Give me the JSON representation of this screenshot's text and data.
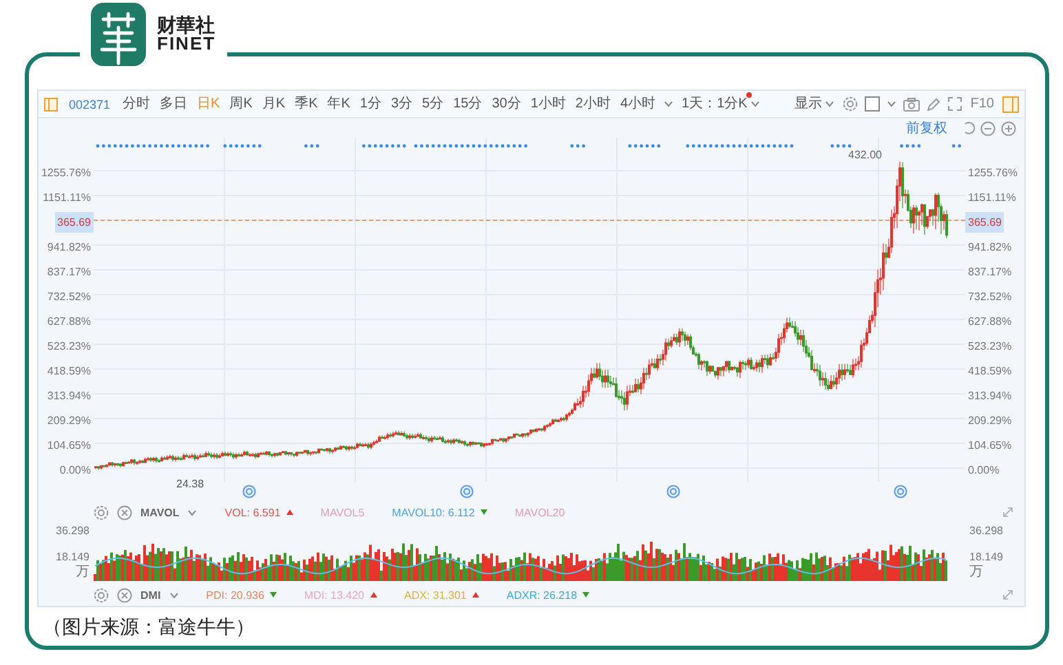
{
  "logo": {
    "name": "财華社",
    "latin": "FINET"
  },
  "toolbar": {
    "code": "002371",
    "periods": [
      {
        "label": "分时",
        "selected": false
      },
      {
        "label": "多日",
        "selected": false
      },
      {
        "label": "日K",
        "selected": true
      },
      {
        "label": "周K",
        "selected": false
      },
      {
        "label": "月K",
        "selected": false
      },
      {
        "label": "季K",
        "selected": false
      },
      {
        "label": "年K",
        "selected": false
      },
      {
        "label": "1分",
        "selected": false
      },
      {
        "label": "3分",
        "selected": false
      },
      {
        "label": "5分",
        "selected": false
      },
      {
        "label": "15分",
        "selected": false
      },
      {
        "label": "30分",
        "selected": false
      },
      {
        "label": "1小时",
        "selected": false
      },
      {
        "label": "2小时",
        "selected": false
      },
      {
        "label": "4小时",
        "selected": false
      }
    ],
    "interval": {
      "label": "1天：1分K",
      "alert": true
    },
    "display": "显示",
    "f10": "F10"
  },
  "chart": {
    "adjust": "前复权",
    "high_label": "432.00",
    "low_label": "24.38",
    "left_axis": [
      {
        "text": "1255.76%",
        "highlighted": false
      },
      {
        "text": "1151.11%",
        "highlighted": false
      },
      {
        "text": "365.69",
        "highlighted": true
      },
      {
        "text": "941.82%",
        "highlighted": false
      },
      {
        "text": "837.17%",
        "highlighted": false
      },
      {
        "text": "732.52%",
        "highlighted": false
      },
      {
        "text": "627.88%",
        "highlighted": false
      },
      {
        "text": "523.23%",
        "highlighted": false
      },
      {
        "text": "418.59%",
        "highlighted": false
      },
      {
        "text": "313.94%",
        "highlighted": false
      },
      {
        "text": "209.29%",
        "highlighted": false
      },
      {
        "text": "104.65%",
        "highlighted": false
      },
      {
        "text": "0.00%",
        "highlighted": false
      }
    ],
    "right_axis": [
      {
        "text": "1255.76%",
        "highlighted": false
      },
      {
        "text": "1151.11%",
        "highlighted": false
      },
      {
        "text": "365.69",
        "highlighted": true
      },
      {
        "text": "941.82%",
        "highlighted": false
      },
      {
        "text": "837.17%",
        "highlighted": false
      },
      {
        "text": "732.52%",
        "highlighted": false
      },
      {
        "text": "627.88%",
        "highlighted": false
      },
      {
        "text": "523.23%",
        "highlighted": false
      },
      {
        "text": "418.59%",
        "highlighted": false
      },
      {
        "text": "313.94%",
        "highlighted": false
      },
      {
        "text": "209.29%",
        "highlighted": false
      },
      {
        "text": "104.65%",
        "highlighted": false
      },
      {
        "text": "0.00%",
        "highlighted": false
      }
    ]
  },
  "volume": {
    "name": "MAVOL",
    "items": [
      {
        "label": "VOL: 6.591",
        "color": "#f0504a",
        "rising": true
      },
      {
        "label": "MAVOL5",
        "color": "#e89ab2"
      },
      {
        "label": "MAVOL10: 6.112",
        "color": "#4aa3e8",
        "rising": false
      },
      {
        "label": "MAVOL20",
        "color": "#e89ab2"
      }
    ],
    "left_axis": [
      "36.298",
      "18.149",
      "万"
    ],
    "right_axis": [
      "36.298",
      "18.149",
      "万"
    ]
  },
  "dmi": {
    "name": "DMI",
    "items": [
      {
        "label": "PDI: 20.936",
        "color": "#f08060",
        "rising": false
      },
      {
        "label": "MDI: 13.420",
        "color": "#f0a0c8",
        "rising": true
      },
      {
        "label": "ADX: 31.301",
        "color": "#e0b030",
        "rising": true
      },
      {
        "label": "ADXR: 26.218",
        "color": "#3aa8e0",
        "rising": false
      }
    ]
  },
  "caption": "（图片来源：富途牛牛）"
}
